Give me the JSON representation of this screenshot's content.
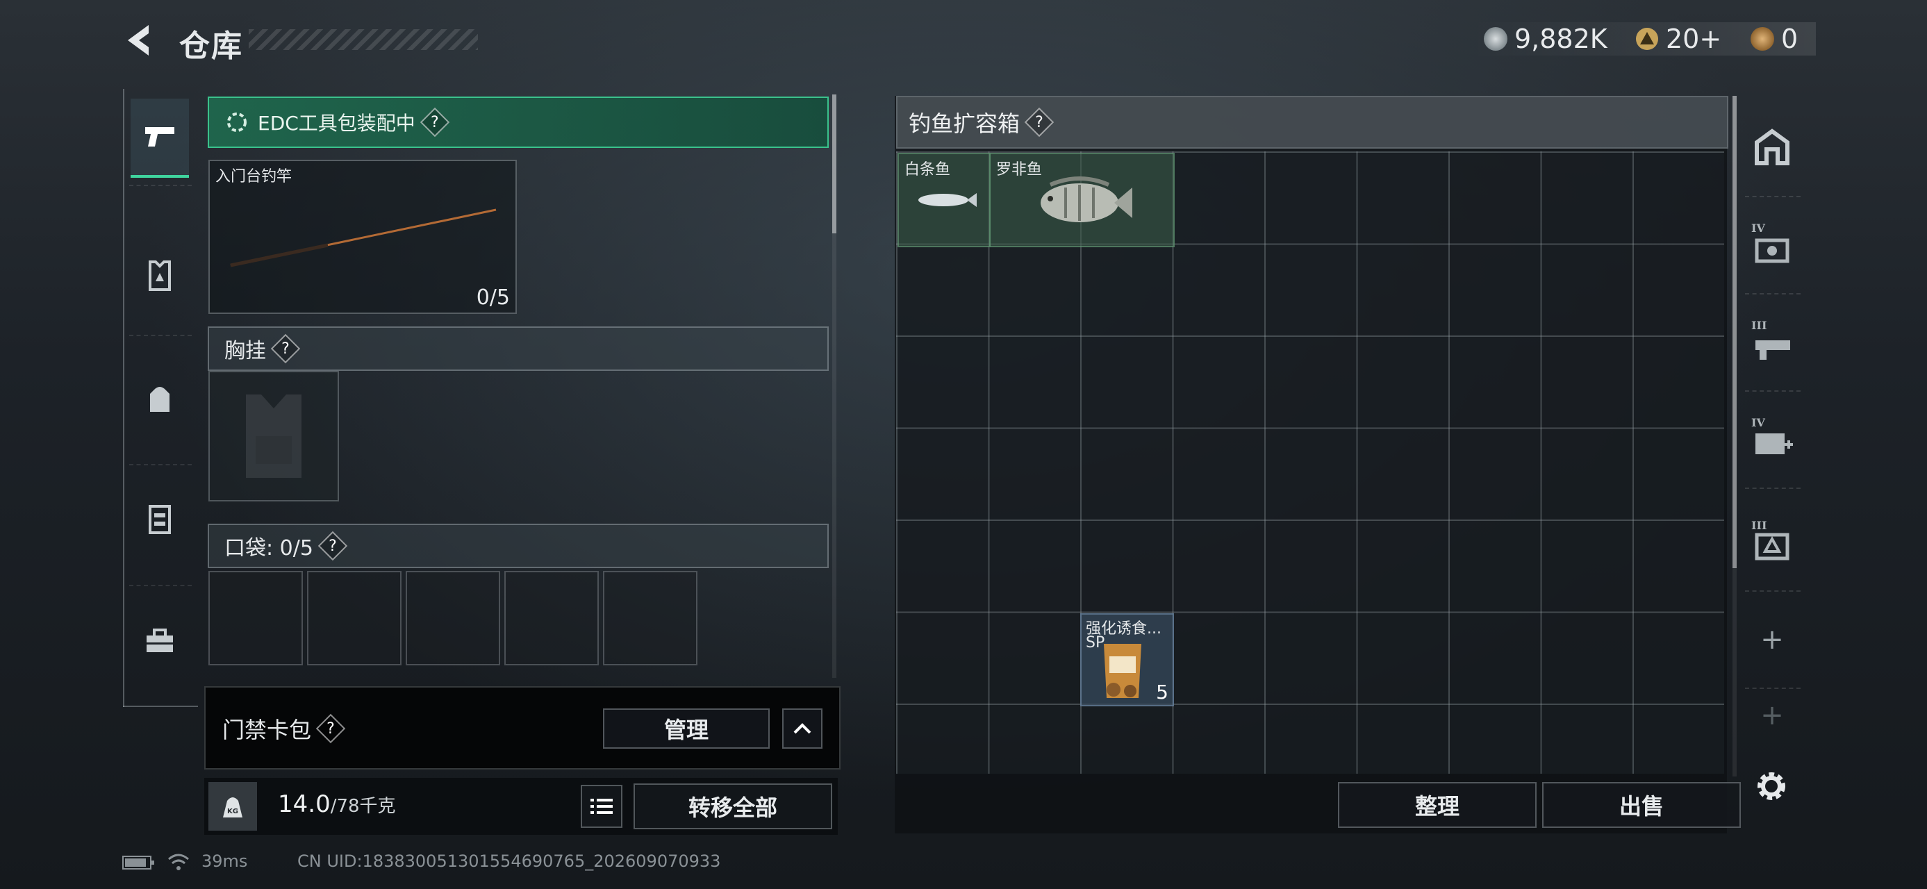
{
  "header": {
    "title": "仓库",
    "currencies": [
      {
        "icon": "silver-coin-icon",
        "value": "9,882K",
        "color": "#9aa3a8"
      },
      {
        "icon": "gold-triangle-coin-icon",
        "value": "20+",
        "color": "#c8a45a"
      },
      {
        "icon": "bronze-coin-icon",
        "value": "0",
        "color": "#b7894c"
      }
    ]
  },
  "left_rail": {
    "items": [
      {
        "icon": "pistol-icon",
        "active": true
      },
      {
        "icon": "armor-vest-icon",
        "active": false
      },
      {
        "icon": "backpack-icon",
        "active": false
      },
      {
        "icon": "chest-rig-icon",
        "active": false
      },
      {
        "icon": "toolbox-icon",
        "active": false
      }
    ]
  },
  "loadout": {
    "edc_status": "EDC工具包装配中",
    "rod": {
      "name": "入门台钓竿",
      "count": "0/5"
    },
    "chest_rig_label": "胸挂",
    "pockets_label": "口袋: 0/5",
    "gate_card_label": "门禁卡包",
    "manage_label": "管理",
    "weight_value": "14.0",
    "weight_max": "/78千克",
    "transfer_all_label": "转移全部"
  },
  "crate": {
    "title": "钓鱼扩容箱",
    "items": [
      {
        "name": "白条鱼"
      },
      {
        "name": "罗非鱼"
      },
      {
        "name": "强化诱食...",
        "tag": "SP",
        "count": "5"
      }
    ],
    "sort_label": "整理",
    "sell_label": "出售"
  },
  "right_rail": {
    "items": [
      {
        "icon": "safehouse-icon"
      },
      {
        "icon": "workbench-iv-icon",
        "tier": "IV"
      },
      {
        "icon": "gun-bench-iii-icon",
        "tier": "III"
      },
      {
        "icon": "medical-iv-icon",
        "tier": "IV"
      },
      {
        "icon": "armor-bench-iii-icon",
        "tier": "III"
      },
      {
        "icon": "add-icon",
        "label": "+"
      },
      {
        "icon": "add-icon",
        "label": "+"
      }
    ],
    "settings_icon": "gear-icon"
  },
  "status_bar": {
    "ping": "39ms",
    "uid": "CN UID:1838300513015546907​65_202609070933"
  }
}
